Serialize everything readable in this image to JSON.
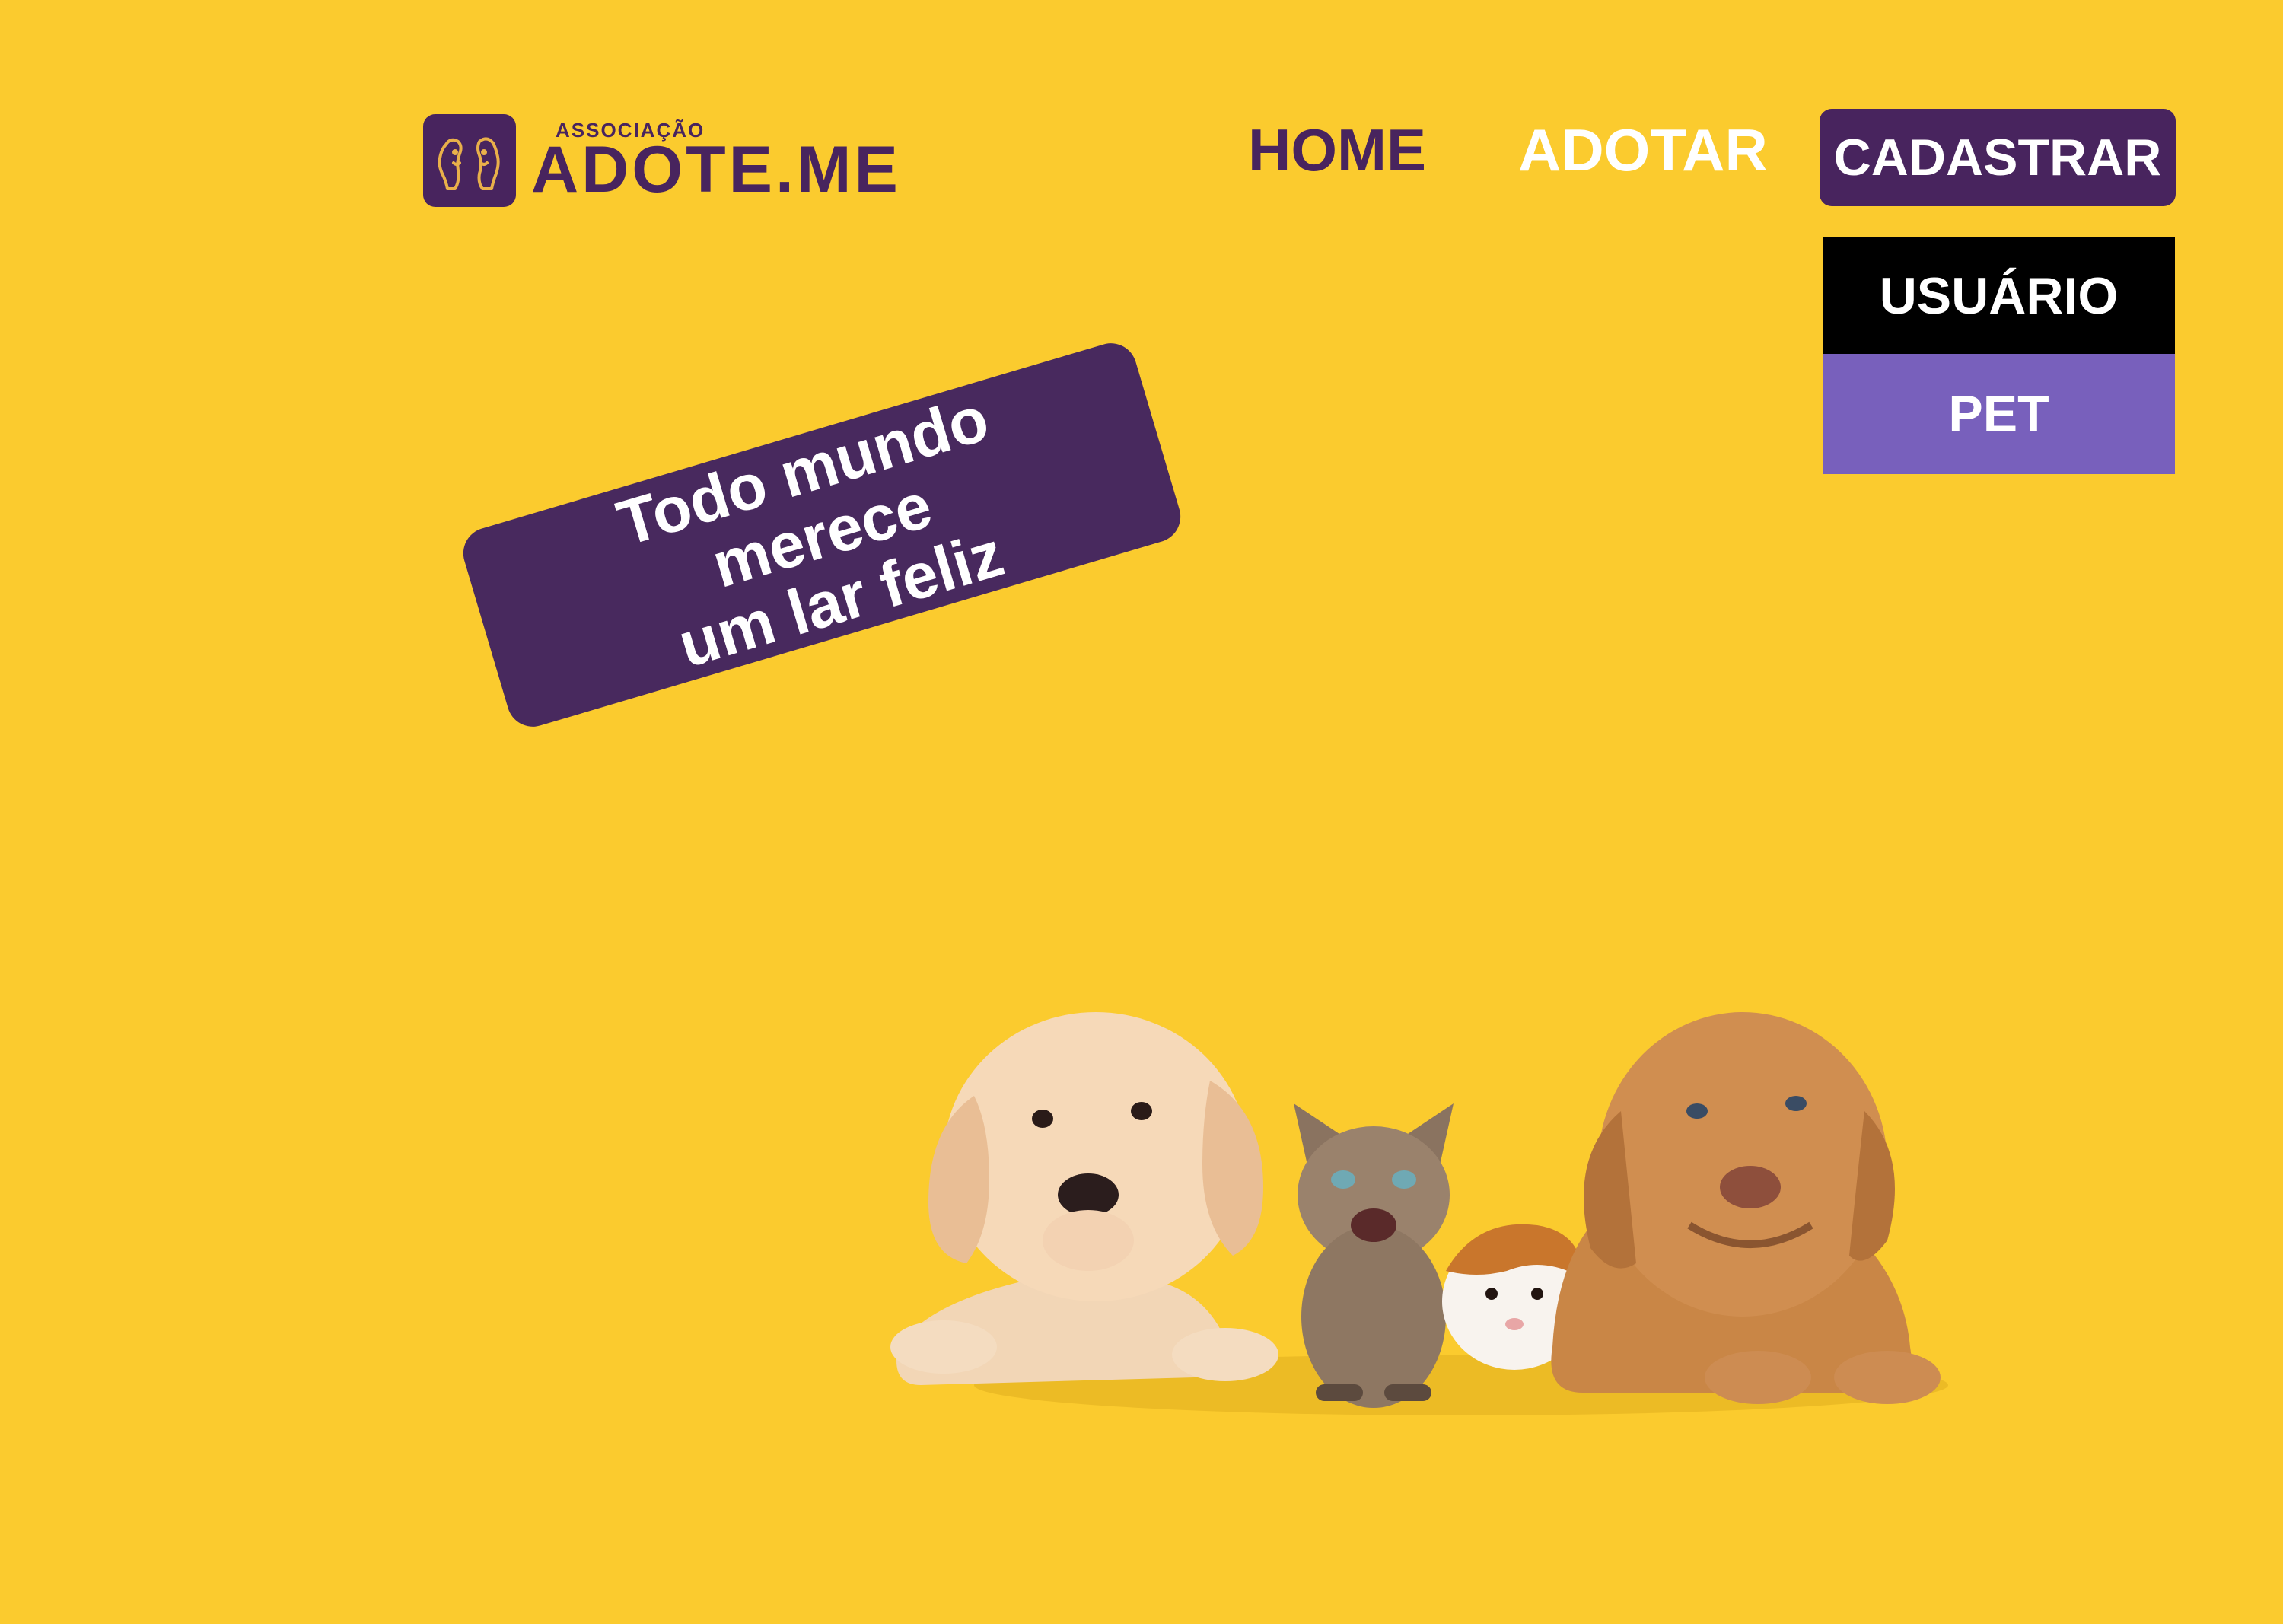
{
  "brand": {
    "small_text": "ASSOCIAÇÃO",
    "name": "ADOTE.ME",
    "logo_icon": "dog-cat-icon",
    "primary_color": "#48245E",
    "background_color": "#FBCB2E"
  },
  "nav": {
    "home": "HOME",
    "adotar": "ADOTAR",
    "cadastrar": "CADASTRAR"
  },
  "dropdown": {
    "items": [
      "USUÁRIO",
      "PET"
    ]
  },
  "hero": {
    "tagline_line1": "Todo mundo merece",
    "tagline_line2": "um lar feliz"
  },
  "illustration": {
    "animals": [
      "puppy-labrador",
      "kitten",
      "guinea-pig",
      "puppy-mastiff"
    ]
  }
}
